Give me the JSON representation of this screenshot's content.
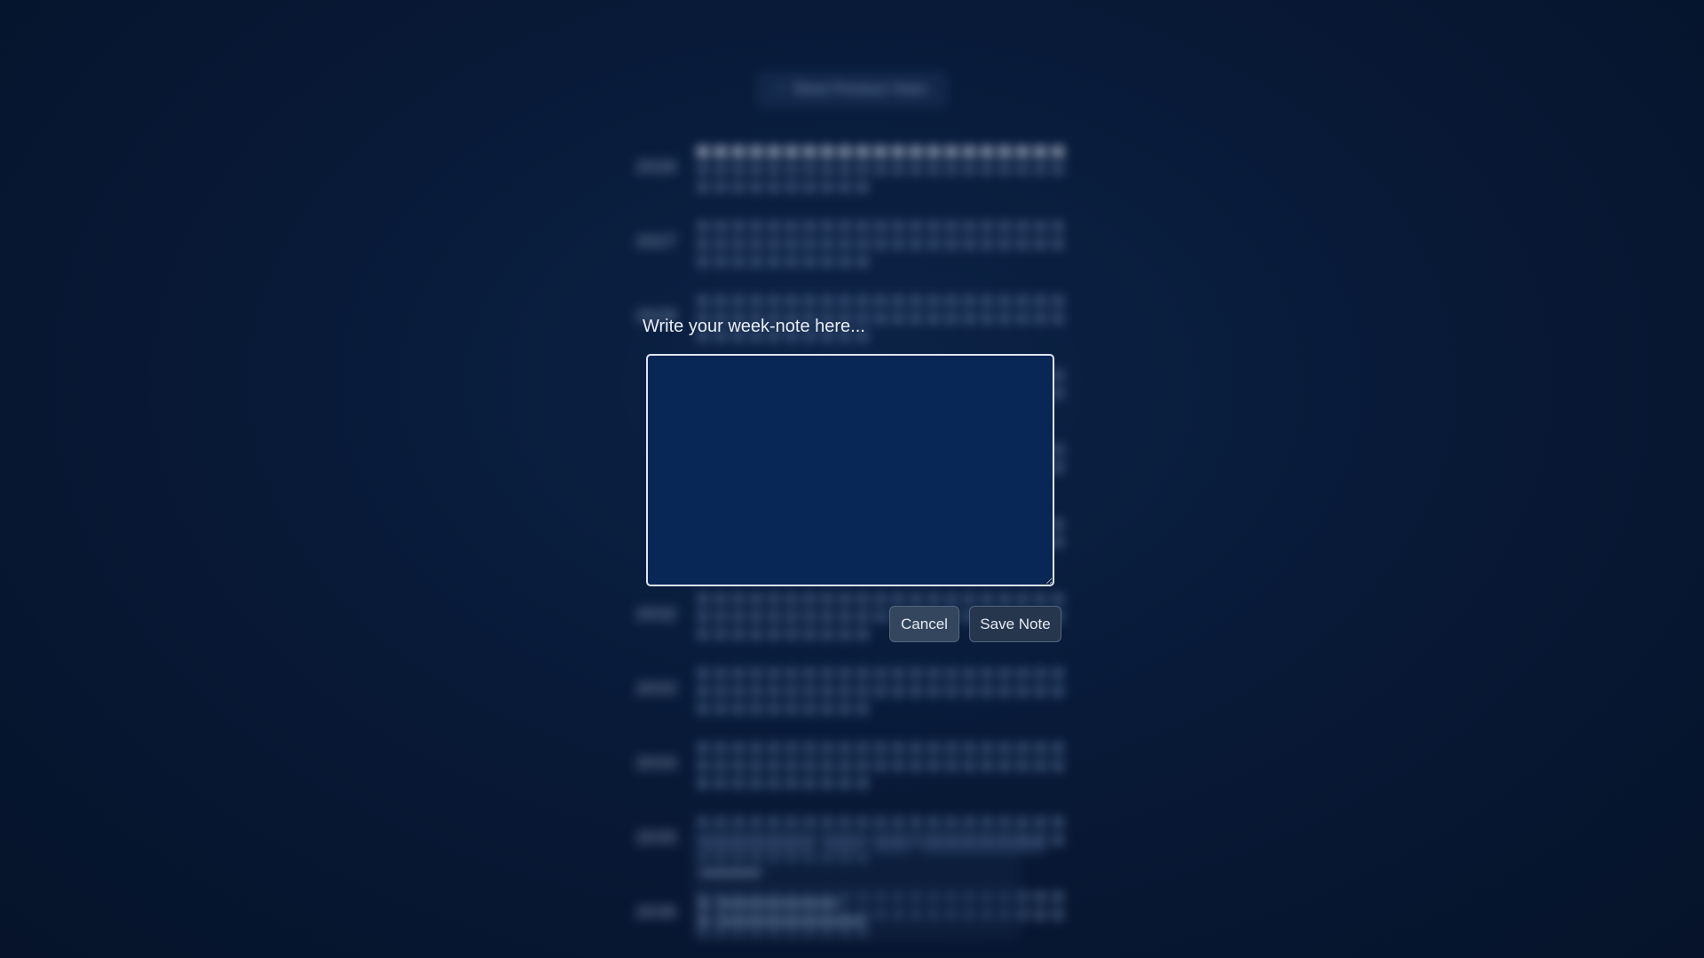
{
  "background": {
    "show_previous_label": "Show Previous Years",
    "arrow_glyph": "↑",
    "years": [
      {
        "label": "2026",
        "lit_count": 21
      },
      {
        "label": "2027",
        "lit_count": 0
      },
      {
        "label": "2028",
        "lit_count": 0
      },
      {
        "label": "",
        "lit_count": 0
      },
      {
        "label": "",
        "lit_count": 0
      },
      {
        "label": "",
        "lit_count": 0
      },
      {
        "label": "2032",
        "lit_count": 0
      },
      {
        "label": "2033",
        "lit_count": 0
      },
      {
        "label": "2034",
        "lit_count": 0
      },
      {
        "label": "2035",
        "lit_count": 0
      },
      {
        "label": "2036",
        "lit_count": 0
      }
    ],
    "weeks_per_year": 52
  },
  "modal": {
    "title": "Write your week-note here...",
    "textarea_value": "",
    "cancel_label": "Cancel",
    "save_label": "Save Note"
  },
  "colors": {
    "textarea_bg": "#082757",
    "textarea_border": "#dfe6f1",
    "button_bg": "#2c3d55",
    "dot": "#4a6286",
    "dot_lit": "#c9d4e4"
  }
}
